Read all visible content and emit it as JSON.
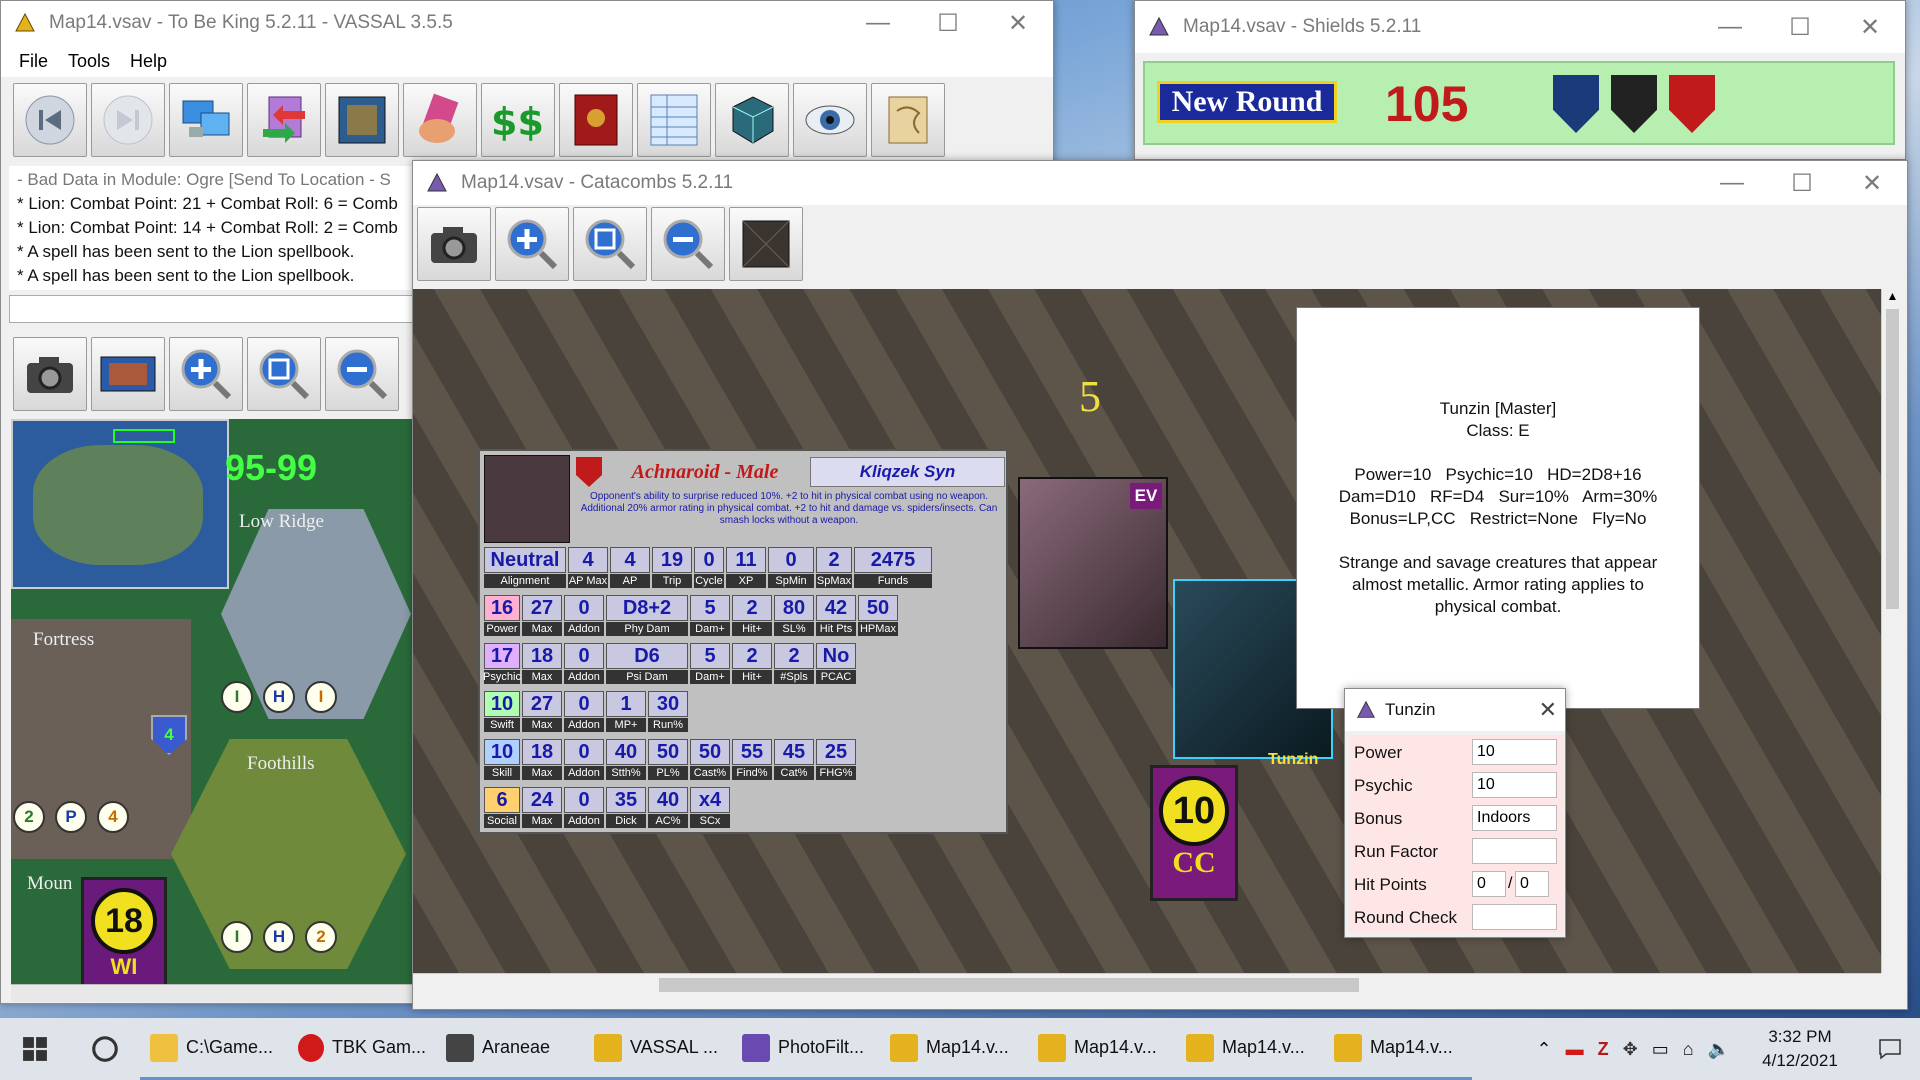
{
  "desktop": {
    "bg": "#2f4f86"
  },
  "main_window": {
    "title": "Map14.vsav - To Be King 5.2.11 - VASSAL 3.5.5",
    "menu": [
      "File",
      "Tools",
      "Help"
    ],
    "toolbar_icons": [
      "step-back-icon",
      "step-forward-icon",
      "server-icon",
      "transfer-icon",
      "map-icon",
      "hand-icon",
      "money-icon",
      "book-icon",
      "spreadsheet-icon",
      "dice-icon",
      "eye-icon",
      "scroll-icon"
    ],
    "chat": [
      "- Bad Data in Module: Ogre [Send To Location - S",
      "* Lion: Combat Point: 21 + Combat Roll: 6 = Comb",
      "* Lion: Combat Point: 14 + Combat Roll: 2 = Comb",
      "* A spell has been sent to the Lion spellbook.",
      "* A spell has been sent to the Lion spellbook."
    ],
    "mini_toolbar_icons": [
      "camera-icon",
      "overview-map-icon",
      "zoom-in-icon",
      "zoom-fit-icon",
      "zoom-out-icon"
    ],
    "map_labels": {
      "range": "95-99",
      "low_ridge": "Low Ridge",
      "fortress": "Fortress",
      "foothills": "Foothills",
      "mount": "Moun",
      "counter": "18",
      "counter_bottom": "WI"
    },
    "tokens_row1": [
      "I",
      "H",
      "I"
    ],
    "tokens_row2": [
      "2",
      "P",
      "4"
    ],
    "tokens_row3": [
      "I",
      "H",
      "2"
    ],
    "shield_number": "4"
  },
  "shields_window": {
    "title": "Map14.vsav - Shields 5.2.11",
    "new_round_label": "New Round",
    "round_number": "105"
  },
  "catacombs_window": {
    "title": "Map14.vsav - Catacombs 5.2.11",
    "toolbar_icons": [
      "camera-icon",
      "zoom-in-icon",
      "zoom-fit-icon",
      "zoom-out-icon",
      "overview-map-icon"
    ],
    "hex_number": "5",
    "character_card": {
      "name": "Achnaroid - Male",
      "owner": "Kliqzek Syn",
      "description": "Opponent's ability to surprise reduced 10%. +2 to hit in physical combat using no weapon. Additional 20% armor rating in physical combat. +2 to hit and damage vs. spiders/insects. Can smash locks without a weapon.",
      "row_align": {
        "values": [
          "Neutral",
          "4",
          "4",
          "19",
          "0",
          "11",
          "0",
          "2",
          "2475"
        ],
        "labels": [
          "Alignment",
          "AP Max",
          "AP",
          "Trip",
          "Cycle",
          "XP",
          "SpMin",
          "SpMax",
          "Funds"
        ]
      },
      "row_power": {
        "values": [
          "16",
          "27",
          "0",
          "D8+2",
          "5",
          "2",
          "80",
          "42",
          "50"
        ],
        "labels": [
          "Power",
          "Max",
          "Addon",
          "Phy Dam",
          "Dam+",
          "Hit+",
          "SL%",
          "Hit Pts",
          "HPMax"
        ]
      },
      "row_psychic": {
        "values": [
          "17",
          "18",
          "0",
          "D6",
          "5",
          "2",
          "2",
          "No"
        ],
        "labels": [
          "Psychic",
          "Max",
          "Addon",
          "Psi Dam",
          "Dam+",
          "Hit+",
          "#Spls",
          "PCAC"
        ]
      },
      "row_swift": {
        "values": [
          "10",
          "27",
          "0",
          "1",
          "30"
        ],
        "labels": [
          "Swift",
          "Max",
          "Addon",
          "MP+",
          "Run%"
        ]
      },
      "row_skill": {
        "values": [
          "10",
          "18",
          "0",
          "40",
          "50",
          "50",
          "55",
          "45",
          "25"
        ],
        "labels": [
          "Skill",
          "Max",
          "Addon",
          "Stth%",
          "PL%",
          "Cast%",
          "Find%",
          "Cat%",
          "FHG%"
        ]
      },
      "row_social": {
        "values": [
          "6",
          "24",
          "0",
          "35",
          "40",
          "x4"
        ],
        "labels": [
          "Social",
          "Max",
          "Addon",
          "Dick",
          "AC%",
          "SCx"
        ]
      }
    },
    "ev_badge": "EV",
    "unit_label": "Tunzin",
    "unit_counter": {
      "top": "10",
      "bottom": "CC"
    },
    "info_panel": {
      "lines": [
        "Tunzin [Master]",
        "Class: E",
        "",
        "Power=10   Psychic=10   HD=2D8+16",
        "Dam=D10   RF=D4   Sur=10%   Arm=30%",
        "Bonus=LP,CC   Restrict=None   Fly=No",
        "",
        "Strange and savage creatures that appear",
        "almost metallic. Armor rating applies to",
        "physical combat."
      ]
    }
  },
  "tunzin_dialog": {
    "title": "Tunzin",
    "fields": [
      {
        "label": "Power",
        "value": "10"
      },
      {
        "label": "Psychic",
        "value": "10"
      },
      {
        "label": "Bonus",
        "value": "Indoors"
      },
      {
        "label": "Run Factor",
        "value": ""
      },
      {
        "label": "Hit Points",
        "value": "0",
        "value2": "0"
      },
      {
        "label": "Round Check",
        "value": ""
      }
    ]
  },
  "taskbar": {
    "items": [
      {
        "label": "C:\\Game...",
        "icon": "folder-icon"
      },
      {
        "label": "TBK Gam...",
        "icon": "opera-icon"
      },
      {
        "label": "Araneae",
        "icon": "spider-icon"
      },
      {
        "label": "VASSAL ...",
        "icon": "vassal-icon"
      },
      {
        "label": "PhotoFilt...",
        "icon": "photofiltre-icon"
      },
      {
        "label": "Map14.v...",
        "icon": "vassal-icon"
      },
      {
        "label": "Map14.v...",
        "icon": "vassal-icon"
      },
      {
        "label": "Map14.v...",
        "icon": "vassal-icon"
      },
      {
        "label": "Map14.v...",
        "icon": "vassal-icon"
      }
    ],
    "time": "3:32 PM",
    "date": "4/12/2021"
  }
}
